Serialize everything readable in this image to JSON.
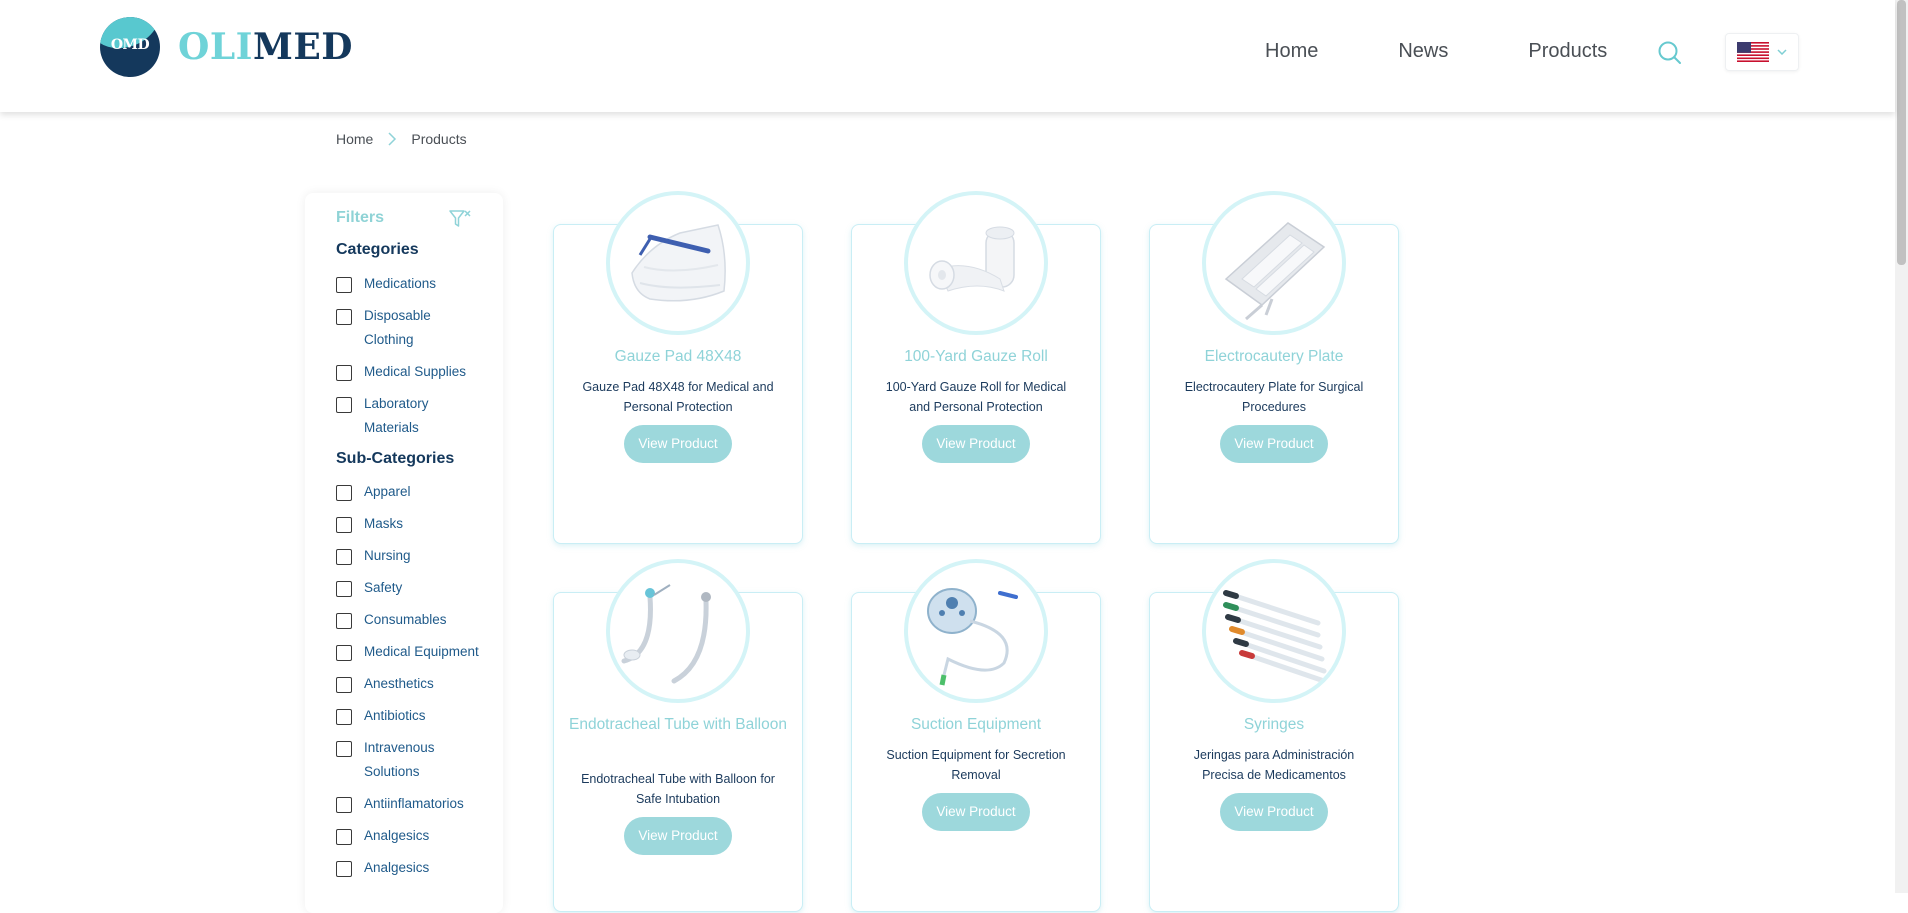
{
  "header": {
    "logo_mark": "OMD",
    "logo_text_a": "OLI",
    "logo_text_b": "MED",
    "nav": [
      "Home",
      "News",
      "Products"
    ],
    "language_flag": "us-flag-icon"
  },
  "breadcrumb": {
    "items": [
      "Home",
      "Products"
    ]
  },
  "sidebar": {
    "filters_title": "Filters",
    "categories_title": "Categories",
    "categories": [
      "Medications",
      "Disposable Clothing",
      "Medical Supplies",
      "Laboratory Materials"
    ],
    "subcategories_title": "Sub-Categories",
    "subcategories": [
      "Apparel",
      "Masks",
      "Nursing",
      "Safety",
      "Consumables",
      "Medical Equipment",
      "Anesthetics",
      "Antibiotics",
      "Intravenous Solutions",
      "Antiinflamatorios",
      "Analgesics",
      "Analgesics"
    ]
  },
  "products": [
    {
      "title": "Gauze Pad 48X48",
      "desc": "Gauze Pad 48X48 for Medical and Personal Protection",
      "button": "View Product",
      "image": "gauze-pad-image"
    },
    {
      "title": "100-Yard Gauze Roll",
      "desc": "100-Yard Gauze Roll for Medical and Personal Protection",
      "button": "View Product",
      "image": "gauze-roll-image"
    },
    {
      "title": "Electrocautery Plate",
      "desc": "Electrocautery Plate for Surgical Procedures",
      "button": "View Product",
      "image": "electrocautery-plate-image"
    },
    {
      "title": "Endotracheal Tube with Balloon",
      "desc": "Endotracheal Tube with Balloon for Safe Intubation",
      "button": "View Product",
      "image": "endotracheal-tube-image"
    },
    {
      "title": "Suction Equipment",
      "desc": "Suction Equipment for Secretion Removal",
      "button": "View Product",
      "image": "suction-equipment-image"
    },
    {
      "title": "Syringes",
      "desc": "Jeringas para Administración Precisa de Medicamentos",
      "button": "View Product",
      "image": "syringes-image"
    }
  ],
  "colors": {
    "accent": "#8fd3d8",
    "navy": "#14385c",
    "button": "#9dd8dc"
  }
}
